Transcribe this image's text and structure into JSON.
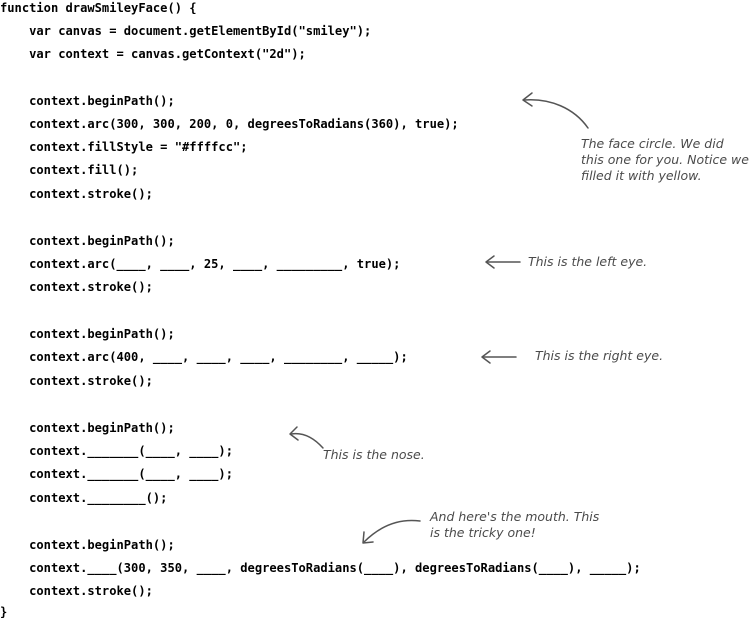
{
  "code": {
    "lines": [
      "function drawSmileyFace() {",
      "    var canvas = document.getElementById(\"smiley\");",
      "    var context = canvas.getContext(\"2d\");",
      "    context.beginPath();",
      "    context.arc(300, 300, 200, 0, degreesToRadians(360), true);",
      "    context.fillStyle = \"#ffffcc\";",
      "    context.fill();",
      "    context.stroke();",
      "    context.beginPath();",
      "    context.arc(____, ____, 25, ____, _________, true);",
      "    context.stroke();",
      "    context.beginPath();",
      "    context.arc(400, ____, ____, ____, ________, _____);",
      "    context.stroke();",
      "    context.beginPath();",
      "    context._______(____, ____);",
      "    context._______(____, ____);",
      "    context.________();",
      "    context.beginPath();",
      "    context.____(300, 350, ____, degreesToRadians(____), degreesToRadians(____), _____);",
      "    context.stroke();",
      "}"
    ]
  },
  "notes": {
    "face": "The face circle. We did\nthis one for you. Notice we\nfilled it with yellow.",
    "left_eye": "This is the left eye.",
    "right_eye": "This is the right eye.",
    "nose": "This is the nose.",
    "mouth": "And here's the mouth. This\nis the tricky one!"
  }
}
